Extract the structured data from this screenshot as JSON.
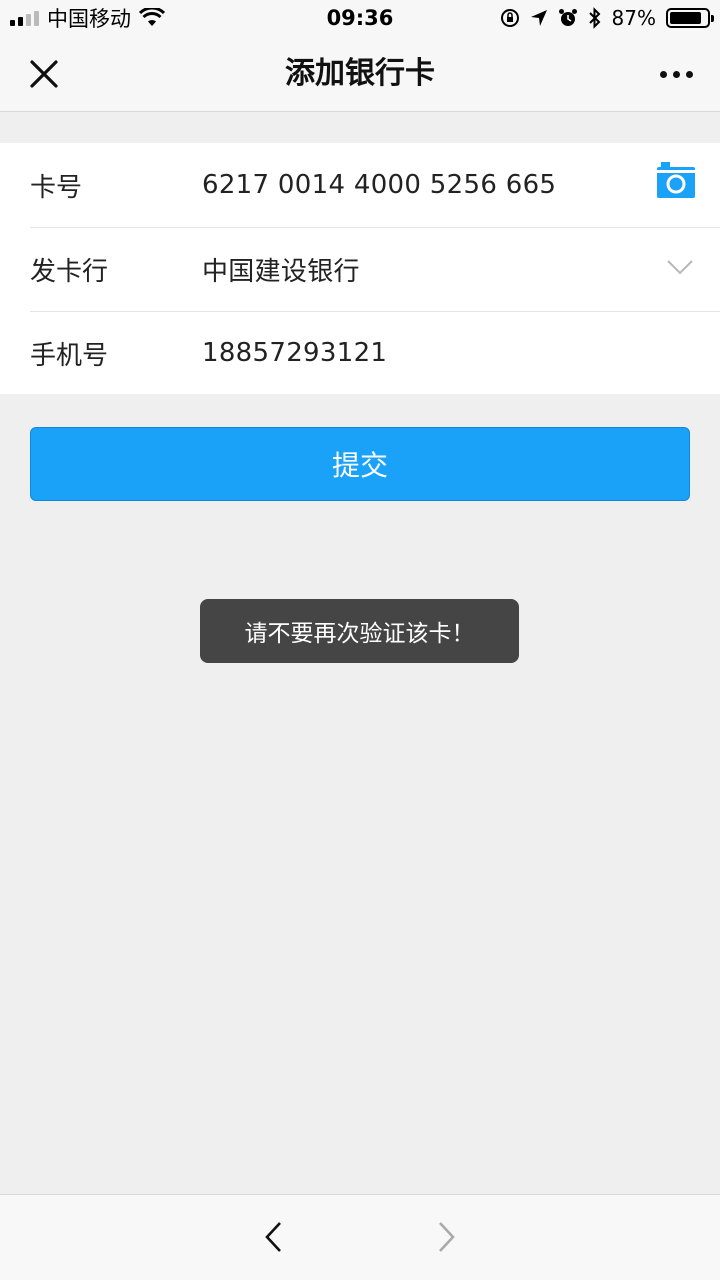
{
  "statusbar": {
    "carrier": "中国移动",
    "time": "09:36",
    "battery": "87%",
    "battery_level": 0.87
  },
  "nav": {
    "title": "添加银行卡"
  },
  "form": {
    "card_number": {
      "label": "卡号",
      "value": "6217 0014 4000 5256 665"
    },
    "issuer": {
      "label": "发卡行",
      "value": "中国建设银行"
    },
    "phone": {
      "label": "手机号",
      "value": "18857293121"
    }
  },
  "submit_label": "提交",
  "toast": "请不要再次验证该卡！",
  "colors": {
    "accent": "#1aa2f9",
    "toast_bg": "#454545",
    "background": "#efefef"
  },
  "icons": [
    "close-icon",
    "more-icon",
    "camera-icon",
    "chevron-down-icon",
    "back-arrow-icon",
    "forward-arrow-icon",
    "wifi-icon",
    "signal-icon",
    "battery-icon"
  ]
}
